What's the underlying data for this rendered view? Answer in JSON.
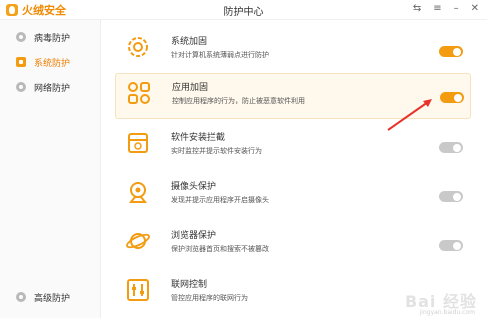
{
  "app": {
    "logo_text": "火绒安全",
    "window_title": "防护中心",
    "controls": [
      "⇆",
      "≡",
      "–",
      "✕"
    ]
  },
  "sidebar": {
    "items": [
      {
        "label": "病毒防护",
        "active": false
      },
      {
        "label": "系统防护",
        "active": true
      },
      {
        "label": "网络防护",
        "active": false
      },
      {
        "label": "高级防护",
        "active": false
      }
    ]
  },
  "features": [
    {
      "name": "系统加固",
      "desc": "针对计算机系统薄弱点进行防护",
      "enabled": true,
      "highlight": false,
      "icon": "gear-shield-icon"
    },
    {
      "name": "应用加固",
      "desc": "控制应用程序的行为，防止被恶意软件利用",
      "enabled": true,
      "highlight": true,
      "icon": "app-grid-icon"
    },
    {
      "name": "软件安装拦截",
      "desc": "实时监控并提示软件安装行为",
      "enabled": false,
      "highlight": false,
      "icon": "package-icon"
    },
    {
      "name": "摄像头保护",
      "desc": "发现并提示应用程序开启摄像头",
      "enabled": false,
      "highlight": false,
      "icon": "camera-icon"
    },
    {
      "name": "浏览器保护",
      "desc": "保护浏览器首页和搜索不被篡改",
      "enabled": false,
      "highlight": false,
      "icon": "planet-icon"
    },
    {
      "name": "联网控制",
      "desc": "管控应用程序的联网行为",
      "enabled": false,
      "highlight": false,
      "icon": "sliders-icon"
    }
  ],
  "watermark": {
    "text": "Bai 经验",
    "sub": "jingyan.baidu.com"
  },
  "colors": {
    "accent": "#f39c12",
    "toggle_off": "#c9c9c9",
    "highlight_bg": "#fff8ec"
  }
}
